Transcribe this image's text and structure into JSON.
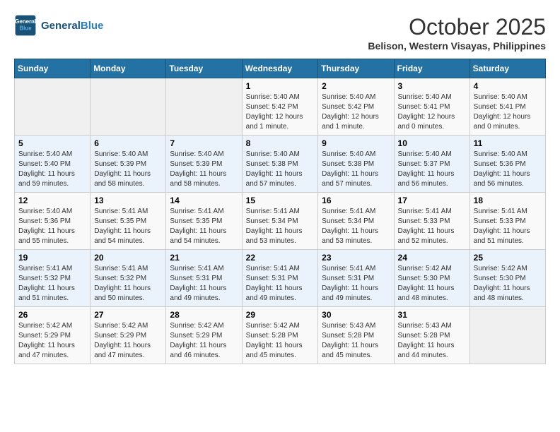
{
  "header": {
    "logo_line1": "General",
    "logo_line2": "Blue",
    "month": "October 2025",
    "location": "Belison, Western Visayas, Philippines"
  },
  "weekdays": [
    "Sunday",
    "Monday",
    "Tuesday",
    "Wednesday",
    "Thursday",
    "Friday",
    "Saturday"
  ],
  "weeks": [
    [
      {
        "day": "",
        "info": ""
      },
      {
        "day": "",
        "info": ""
      },
      {
        "day": "",
        "info": ""
      },
      {
        "day": "1",
        "info": "Sunrise: 5:40 AM\nSunset: 5:42 PM\nDaylight: 12 hours\nand 1 minute."
      },
      {
        "day": "2",
        "info": "Sunrise: 5:40 AM\nSunset: 5:42 PM\nDaylight: 12 hours\nand 1 minute."
      },
      {
        "day": "3",
        "info": "Sunrise: 5:40 AM\nSunset: 5:41 PM\nDaylight: 12 hours\nand 0 minutes."
      },
      {
        "day": "4",
        "info": "Sunrise: 5:40 AM\nSunset: 5:41 PM\nDaylight: 12 hours\nand 0 minutes."
      }
    ],
    [
      {
        "day": "5",
        "info": "Sunrise: 5:40 AM\nSunset: 5:40 PM\nDaylight: 11 hours\nand 59 minutes."
      },
      {
        "day": "6",
        "info": "Sunrise: 5:40 AM\nSunset: 5:39 PM\nDaylight: 11 hours\nand 58 minutes."
      },
      {
        "day": "7",
        "info": "Sunrise: 5:40 AM\nSunset: 5:39 PM\nDaylight: 11 hours\nand 58 minutes."
      },
      {
        "day": "8",
        "info": "Sunrise: 5:40 AM\nSunset: 5:38 PM\nDaylight: 11 hours\nand 57 minutes."
      },
      {
        "day": "9",
        "info": "Sunrise: 5:40 AM\nSunset: 5:38 PM\nDaylight: 11 hours\nand 57 minutes."
      },
      {
        "day": "10",
        "info": "Sunrise: 5:40 AM\nSunset: 5:37 PM\nDaylight: 11 hours\nand 56 minutes."
      },
      {
        "day": "11",
        "info": "Sunrise: 5:40 AM\nSunset: 5:36 PM\nDaylight: 11 hours\nand 56 minutes."
      }
    ],
    [
      {
        "day": "12",
        "info": "Sunrise: 5:40 AM\nSunset: 5:36 PM\nDaylight: 11 hours\nand 55 minutes."
      },
      {
        "day": "13",
        "info": "Sunrise: 5:41 AM\nSunset: 5:35 PM\nDaylight: 11 hours\nand 54 minutes."
      },
      {
        "day": "14",
        "info": "Sunrise: 5:41 AM\nSunset: 5:35 PM\nDaylight: 11 hours\nand 54 minutes."
      },
      {
        "day": "15",
        "info": "Sunrise: 5:41 AM\nSunset: 5:34 PM\nDaylight: 11 hours\nand 53 minutes."
      },
      {
        "day": "16",
        "info": "Sunrise: 5:41 AM\nSunset: 5:34 PM\nDaylight: 11 hours\nand 53 minutes."
      },
      {
        "day": "17",
        "info": "Sunrise: 5:41 AM\nSunset: 5:33 PM\nDaylight: 11 hours\nand 52 minutes."
      },
      {
        "day": "18",
        "info": "Sunrise: 5:41 AM\nSunset: 5:33 PM\nDaylight: 11 hours\nand 51 minutes."
      }
    ],
    [
      {
        "day": "19",
        "info": "Sunrise: 5:41 AM\nSunset: 5:32 PM\nDaylight: 11 hours\nand 51 minutes."
      },
      {
        "day": "20",
        "info": "Sunrise: 5:41 AM\nSunset: 5:32 PM\nDaylight: 11 hours\nand 50 minutes."
      },
      {
        "day": "21",
        "info": "Sunrise: 5:41 AM\nSunset: 5:31 PM\nDaylight: 11 hours\nand 49 minutes."
      },
      {
        "day": "22",
        "info": "Sunrise: 5:41 AM\nSunset: 5:31 PM\nDaylight: 11 hours\nand 49 minutes."
      },
      {
        "day": "23",
        "info": "Sunrise: 5:41 AM\nSunset: 5:31 PM\nDaylight: 11 hours\nand 49 minutes."
      },
      {
        "day": "24",
        "info": "Sunrise: 5:42 AM\nSunset: 5:30 PM\nDaylight: 11 hours\nand 48 minutes."
      },
      {
        "day": "25",
        "info": "Sunrise: 5:42 AM\nSunset: 5:30 PM\nDaylight: 11 hours\nand 48 minutes."
      }
    ],
    [
      {
        "day": "26",
        "info": "Sunrise: 5:42 AM\nSunset: 5:29 PM\nDaylight: 11 hours\nand 47 minutes."
      },
      {
        "day": "27",
        "info": "Sunrise: 5:42 AM\nSunset: 5:29 PM\nDaylight: 11 hours\nand 47 minutes."
      },
      {
        "day": "28",
        "info": "Sunrise: 5:42 AM\nSunset: 5:29 PM\nDaylight: 11 hours\nand 46 minutes."
      },
      {
        "day": "29",
        "info": "Sunrise: 5:42 AM\nSunset: 5:28 PM\nDaylight: 11 hours\nand 45 minutes."
      },
      {
        "day": "30",
        "info": "Sunrise: 5:43 AM\nSunset: 5:28 PM\nDaylight: 11 hours\nand 45 minutes."
      },
      {
        "day": "31",
        "info": "Sunrise: 5:43 AM\nSunset: 5:28 PM\nDaylight: 11 hours\nand 44 minutes."
      },
      {
        "day": "",
        "info": ""
      }
    ]
  ]
}
